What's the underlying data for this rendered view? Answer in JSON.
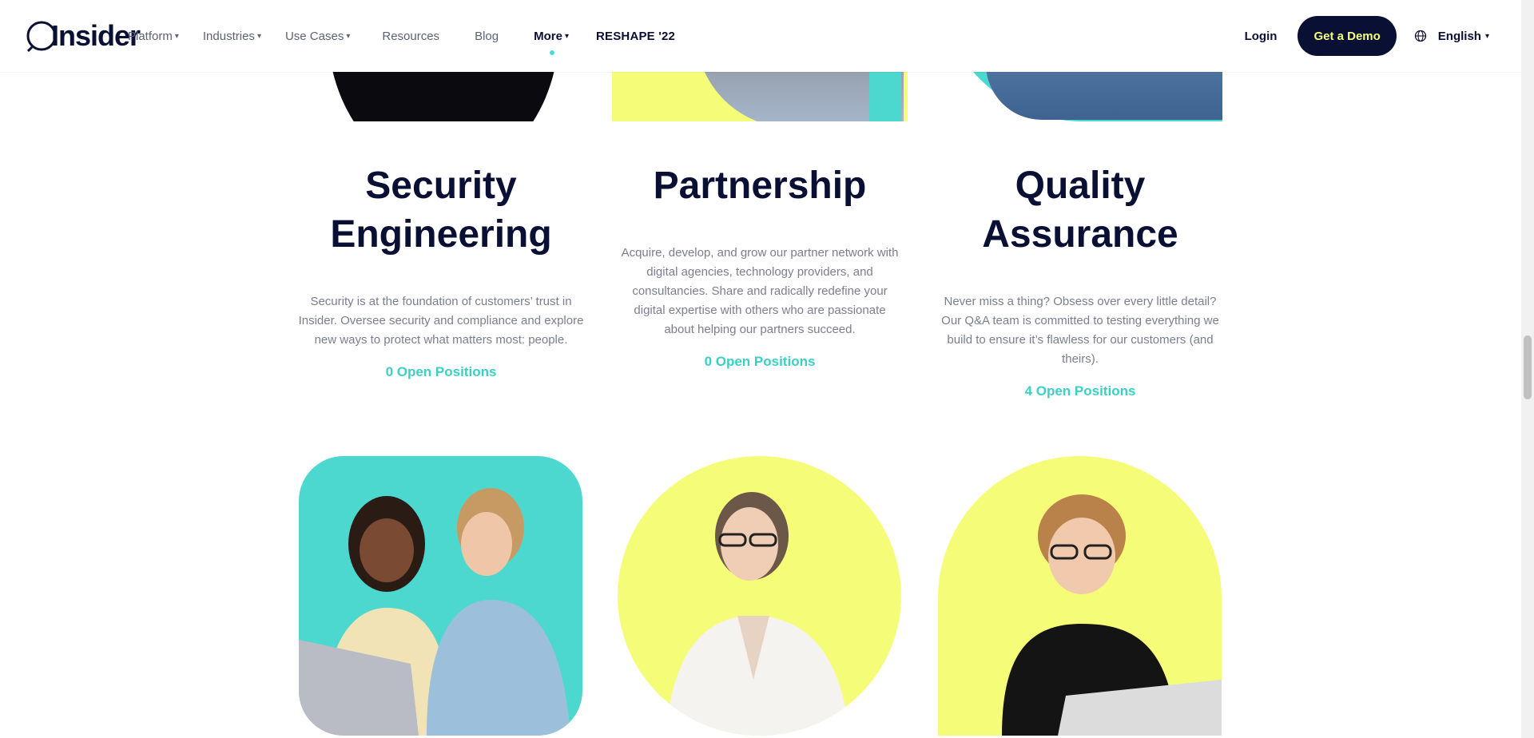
{
  "header": {
    "logo_text": "Insider",
    "nav": [
      {
        "label": "Platform",
        "caret": true
      },
      {
        "label": "Industries",
        "caret": true
      },
      {
        "label": "Use Cases",
        "caret": true
      },
      {
        "label": "Resources",
        "caret": false
      },
      {
        "label": "Blog",
        "caret": false
      },
      {
        "label": "More",
        "caret": true
      },
      {
        "label": "RESHAPE '22",
        "caret": false
      }
    ],
    "login": "Login",
    "demo": "Get a Demo",
    "language": "English",
    "caret_glyph": "▾"
  },
  "cards": [
    {
      "title_line1": "Security",
      "title_line2": "Engineering",
      "description": "Security is at the foundation of customers’ trust in Insider. Oversee security and compliance and explore new ways to protect what matters most: people.",
      "link": "0 Open Positions"
    },
    {
      "title_line1": "Partnership",
      "description": "Acquire, develop, and grow our partner network with digital agencies, technology providers, and consultancies. Share and radically redefine your digital expertise with others who are passionate about helping our partners succeed.",
      "link": "0 Open Positions"
    },
    {
      "title_line1": "Quality",
      "title_line2": "Assurance",
      "description": "Never miss a thing? Obsess over every little detail? Our Q&A team is committed to testing everything we build to ensure it’s flawless for our customers (and theirs).",
      "link": "4 Open Positions"
    }
  ],
  "colors": {
    "navy": "#0a1034",
    "teal": "#4cd8cf",
    "yellow": "#f5fd78",
    "link": "#3ad0c4"
  },
  "icons": [
    "globe-icon",
    "caret-down-icon"
  ]
}
